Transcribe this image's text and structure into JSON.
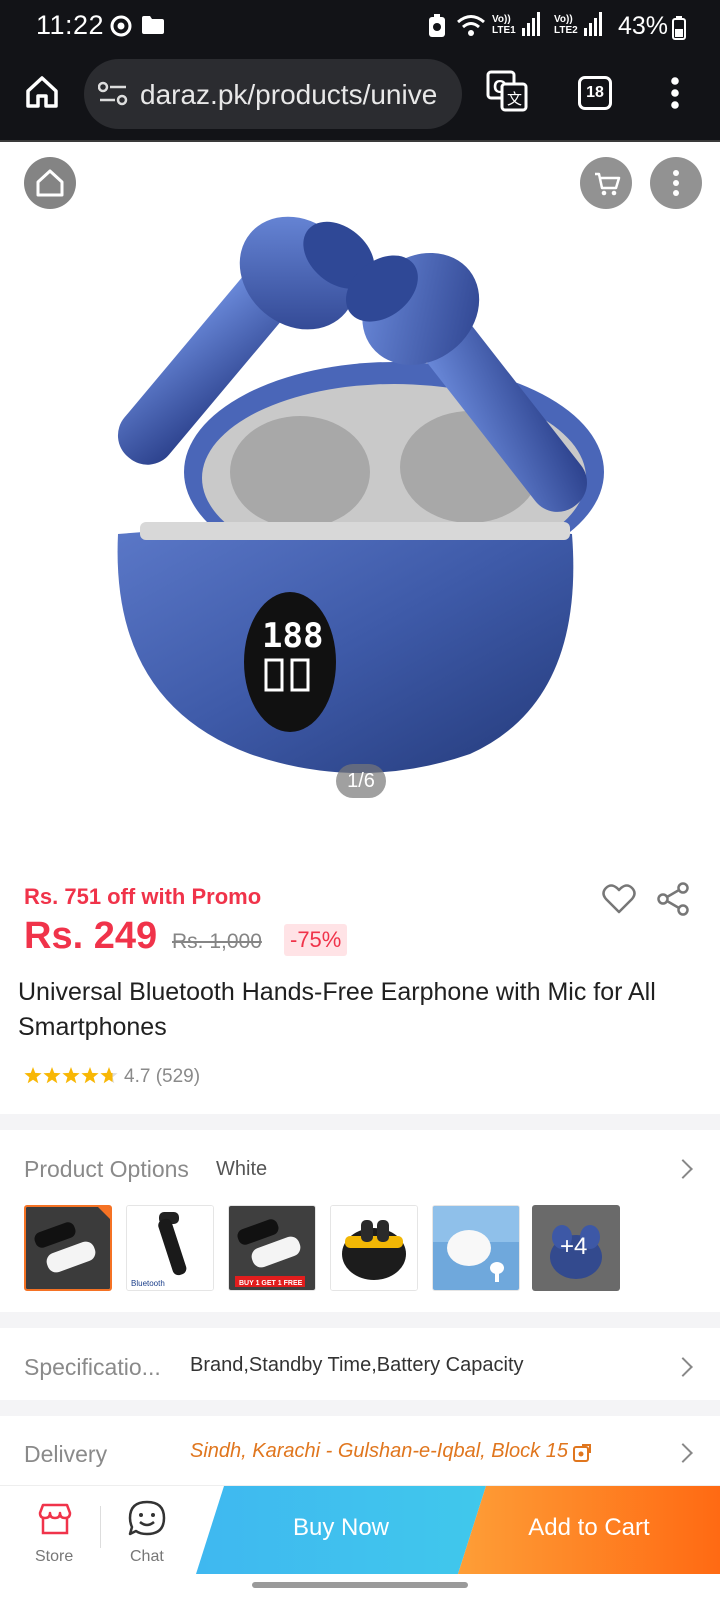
{
  "status": {
    "time": "11:22",
    "battery": "43%",
    "sim1": "LTE1",
    "sim2": "LTE2"
  },
  "browser": {
    "url": "daraz.pk/products/unive",
    "tab_count": "18"
  },
  "gallery": {
    "counter": "1/6"
  },
  "product": {
    "promo": "Rs. 751 off with Promo",
    "price": "Rs. 249",
    "old_price": "Rs. 1,000",
    "discount": "-75%",
    "title": "Universal Bluetooth Hands-Free Earphone with Mic for All Smartphones",
    "rating": "4.7",
    "reviews": "(529)",
    "stars_value": 4.7
  },
  "options": {
    "label": "Product Options",
    "selected": "White",
    "more": "+4",
    "thumb_texts": {
      "bluetooth": "Bluetooth",
      "promo": "BUY 1 GET 1 FREE"
    }
  },
  "specs": {
    "label": "Specificatio...",
    "value": "Brand,Standby Time,Battery Capacity"
  },
  "delivery": {
    "label": "Delivery",
    "value": "Sindh, Karachi - Gulshan-e-Iqbal, Block 15"
  },
  "bottom": {
    "store": "Store",
    "chat": "Chat",
    "buy_now": "Buy Now",
    "add_to_cart": "Add to Cart"
  },
  "colors": {
    "brand_red": "#f0334a",
    "brand_orange": "#f57224",
    "buy_blue": "#40c8ec",
    "delivery_orange": "#e0761e"
  }
}
